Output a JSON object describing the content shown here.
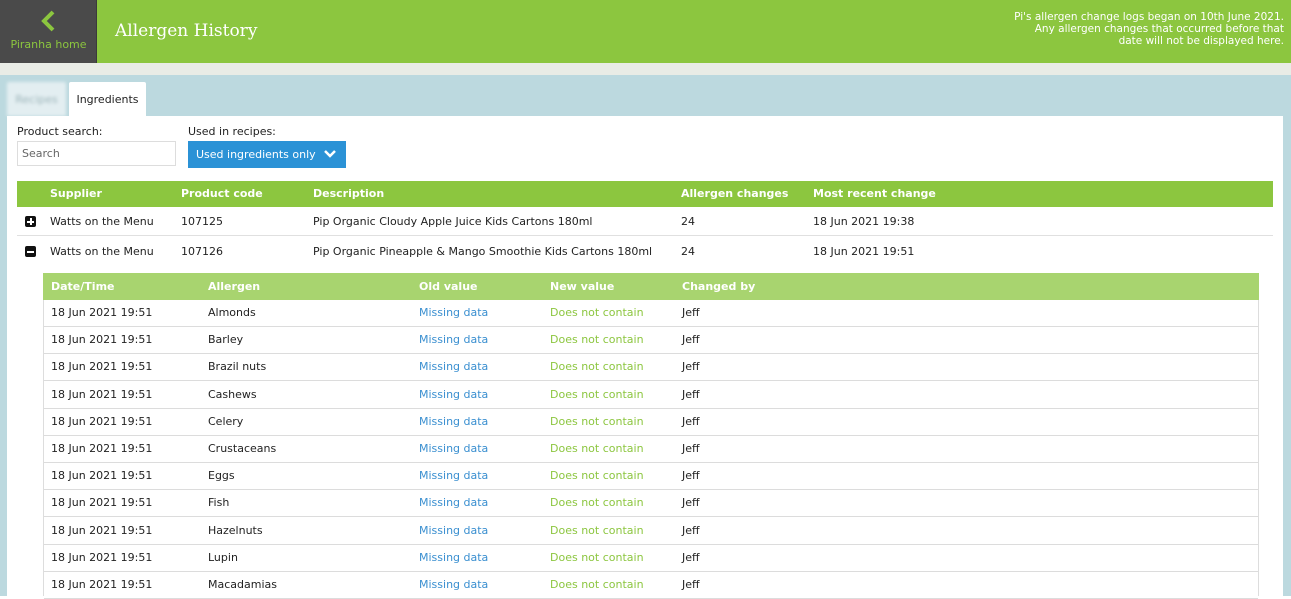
{
  "header": {
    "home_label": "Piranha home",
    "title": "Allergen History",
    "notice_lines": [
      "Pi's allergen change logs began on 10th June 2021.",
      "Any allergen changes that occurred before that",
      "date will not be displayed here."
    ]
  },
  "tabs": [
    {
      "label": "Recipes",
      "active": false
    },
    {
      "label": "Ingredients",
      "active": true
    }
  ],
  "filters": {
    "product_search_label": "Product search:",
    "search_placeholder": "Search",
    "used_in_label": "Used in recipes:",
    "used_in_value": "Used ingredients only"
  },
  "table": {
    "columns": [
      "Supplier",
      "Product code",
      "Description",
      "Allergen changes",
      "Most recent change"
    ],
    "rows": [
      {
        "expanded": false,
        "supplier": "Watts on the Menu",
        "code": "107125",
        "description": "Pip Organic Cloudy Apple Juice Kids Cartons 180ml",
        "changes": "24",
        "recent": "18 Jun 2021 19:38"
      },
      {
        "expanded": true,
        "supplier": "Watts on the Menu",
        "code": "107126",
        "description": "Pip Organic Pineapple & Mango Smoothie Kids Cartons 180ml",
        "changes": "24",
        "recent": "18 Jun 2021 19:51"
      }
    ]
  },
  "history": {
    "columns": [
      "Date/Time",
      "Allergen",
      "Old value",
      "New value",
      "Changed by"
    ],
    "rows": [
      {
        "datetime": "18 Jun 2021 19:51",
        "allergen": "Almonds",
        "old": "Missing data",
        "new": "Does not contain",
        "by": "Jeff"
      },
      {
        "datetime": "18 Jun 2021 19:51",
        "allergen": "Barley",
        "old": "Missing data",
        "new": "Does not contain",
        "by": "Jeff"
      },
      {
        "datetime": "18 Jun 2021 19:51",
        "allergen": "Brazil nuts",
        "old": "Missing data",
        "new": "Does not contain",
        "by": "Jeff"
      },
      {
        "datetime": "18 Jun 2021 19:51",
        "allergen": "Cashews",
        "old": "Missing data",
        "new": "Does not contain",
        "by": "Jeff"
      },
      {
        "datetime": "18 Jun 2021 19:51",
        "allergen": "Celery",
        "old": "Missing data",
        "new": "Does not contain",
        "by": "Jeff"
      },
      {
        "datetime": "18 Jun 2021 19:51",
        "allergen": "Crustaceans",
        "old": "Missing data",
        "new": "Does not contain",
        "by": "Jeff"
      },
      {
        "datetime": "18 Jun 2021 19:51",
        "allergen": "Eggs",
        "old": "Missing data",
        "new": "Does not contain",
        "by": "Jeff"
      },
      {
        "datetime": "18 Jun 2021 19:51",
        "allergen": "Fish",
        "old": "Missing data",
        "new": "Does not contain",
        "by": "Jeff"
      },
      {
        "datetime": "18 Jun 2021 19:51",
        "allergen": "Hazelnuts",
        "old": "Missing data",
        "new": "Does not contain",
        "by": "Jeff"
      },
      {
        "datetime": "18 Jun 2021 19:51",
        "allergen": "Lupin",
        "old": "Missing data",
        "new": "Does not contain",
        "by": "Jeff"
      },
      {
        "datetime": "18 Jun 2021 19:51",
        "allergen": "Macadamias",
        "old": "Missing data",
        "new": "Does not contain",
        "by": "Jeff"
      }
    ]
  },
  "colors": {
    "brand_green": "#8cc63f",
    "sub_header_green": "#a8d46f",
    "link_blue": "#3a8fd0",
    "dropdown_blue": "#2b92d6",
    "home_bg": "#4a4a4a"
  },
  "icons": {
    "back": "chevron-left-icon",
    "dropdown": "chevron-down-icon",
    "expand": "plus-square-icon",
    "collapse": "minus-square-icon"
  }
}
